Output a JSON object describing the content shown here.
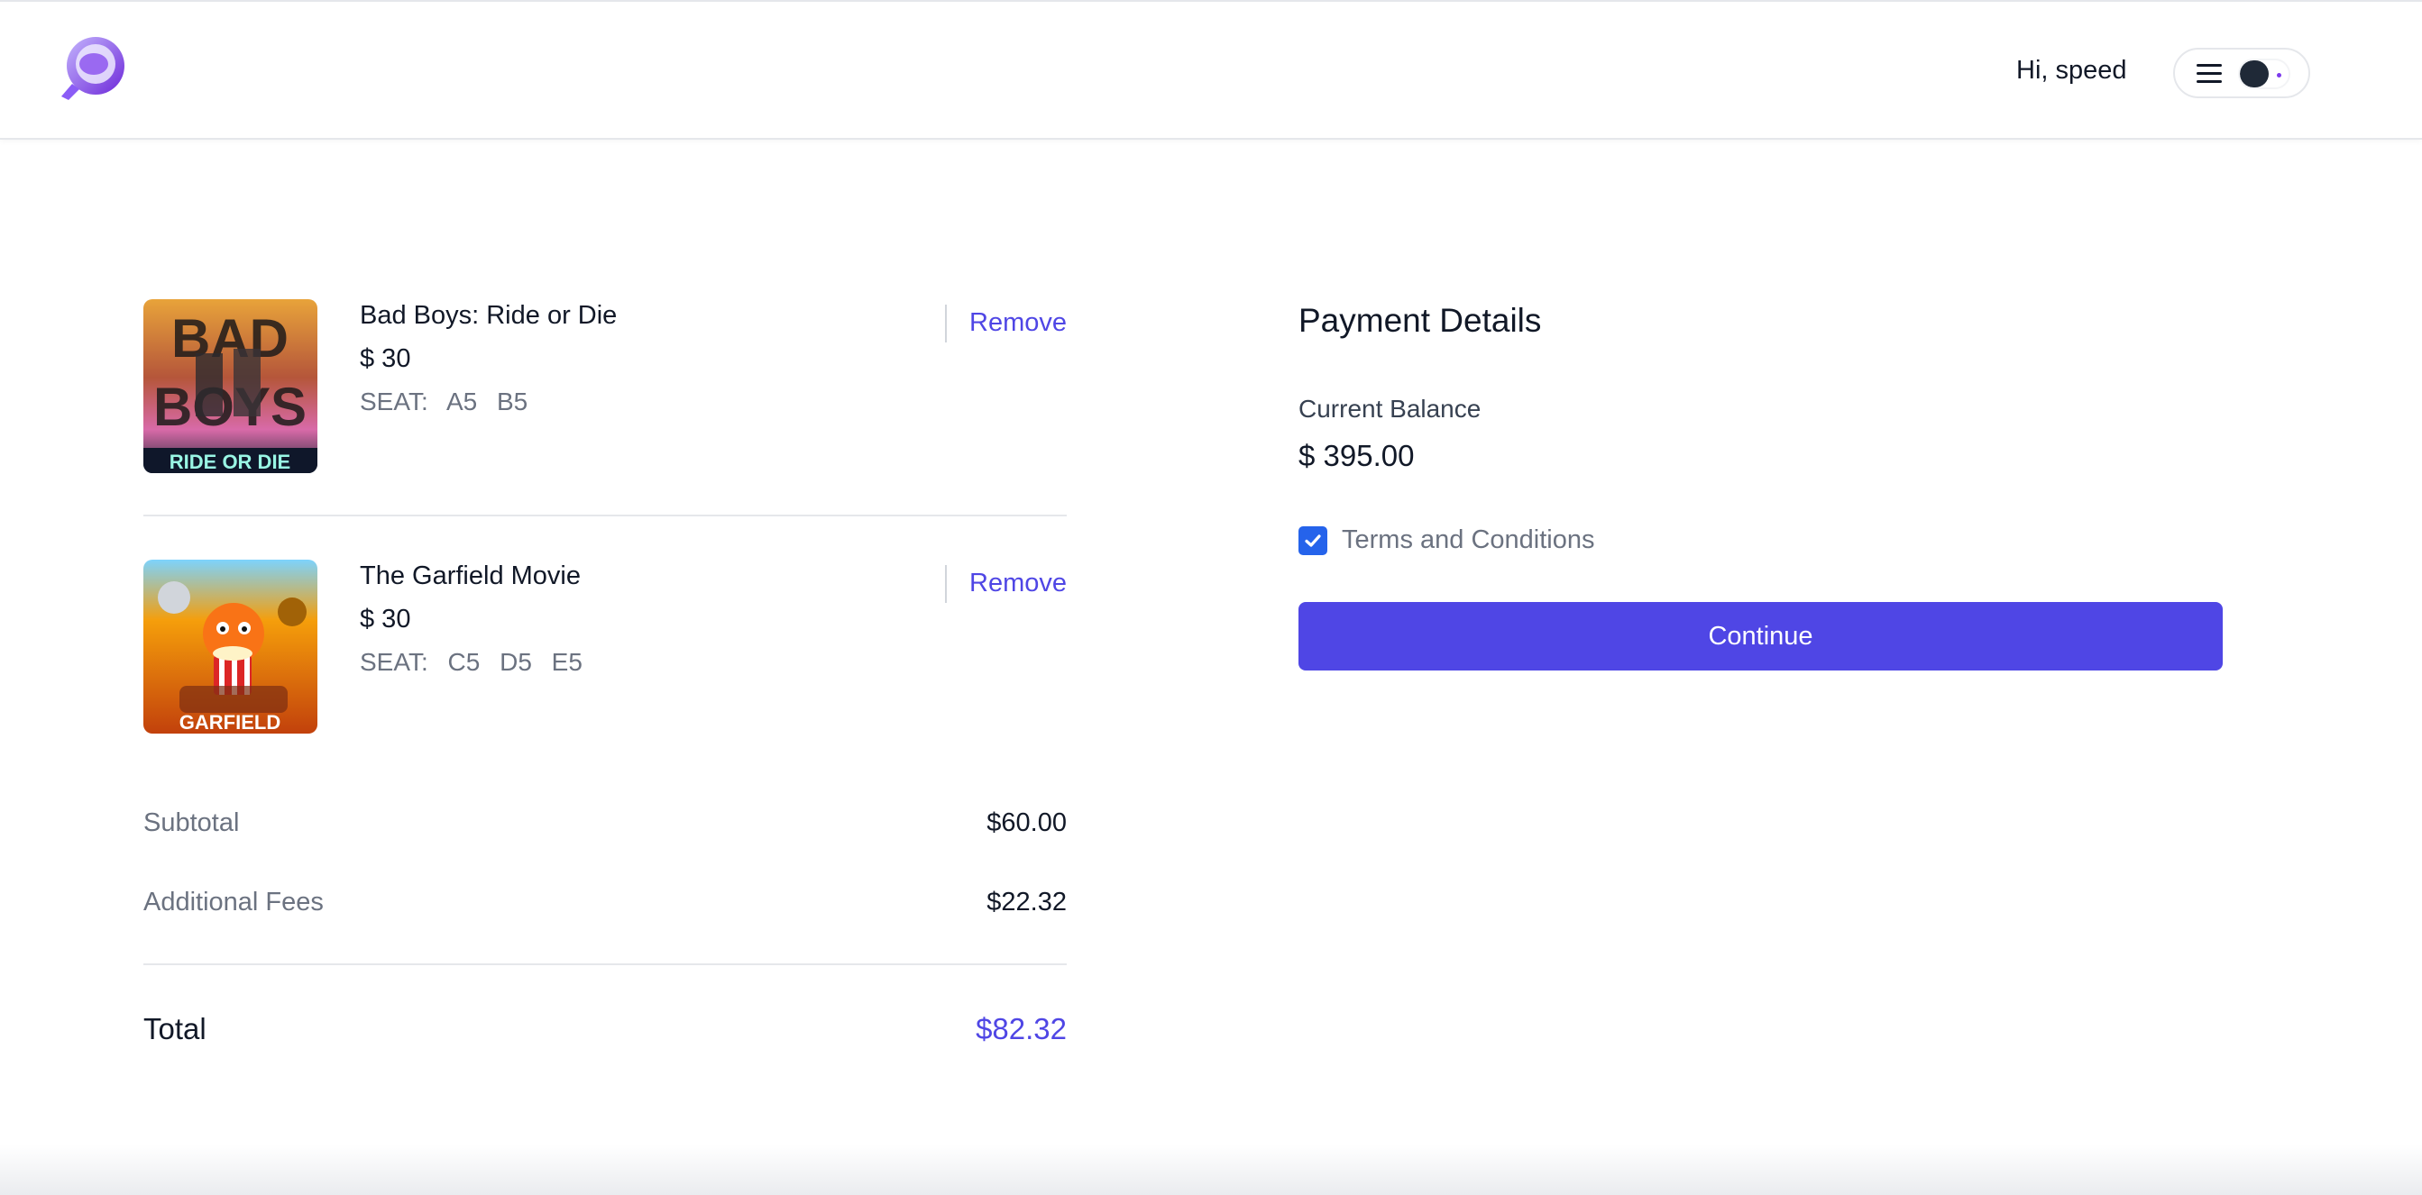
{
  "header": {
    "greeting": "Hi, speed",
    "logo_icon": "app-logo-icon",
    "menu_icon": "hamburger-menu-icon"
  },
  "cart": {
    "items": [
      {
        "title": "Bad Boys: Ride or Die",
        "price": "$ 30",
        "seat_label": "SEAT:",
        "seats": [
          "A5",
          "B5"
        ],
        "remove_label": "Remove",
        "poster_text_top": "BAD",
        "poster_text_mid": "BOYS",
        "poster_text_bottom": "RIDE OR DIE"
      },
      {
        "title": "The Garfield Movie",
        "price": "$ 30",
        "seat_label": "SEAT:",
        "seats": [
          "C5",
          "D5",
          "E5"
        ],
        "remove_label": "Remove",
        "poster_text_bottom": "GARFIELD"
      }
    ],
    "subtotal_label": "Subtotal",
    "subtotal_value": "$60.00",
    "fees_label": "Additional Fees",
    "fees_value": "$22.32",
    "total_label": "Total",
    "total_value": "$82.32"
  },
  "payment": {
    "title": "Payment Details",
    "balance_label": "Current Balance",
    "balance_value": "$ 395.00",
    "terms_label": "Terms and Conditions",
    "terms_checked": true,
    "continue_label": "Continue"
  },
  "colors": {
    "accent": "#4f46e5",
    "checkbox": "#2563eb",
    "muted_text": "#6b7280"
  }
}
